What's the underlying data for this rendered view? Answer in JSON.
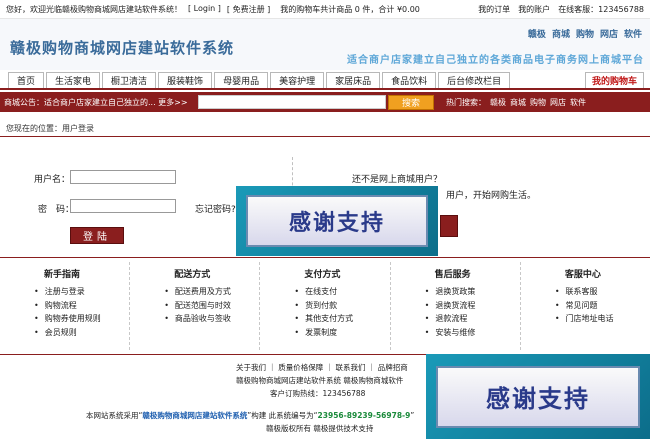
{
  "topbar": {
    "welcome": "您好，欢迎光临赣极购物商城网店建站软件系统！",
    "login": "[ Login ]",
    "register": "[ 免费注册 ]",
    "cart_summary": "我的购物车共计商品 0 件，合计 ¥0.00",
    "links": [
      "我的订单",
      "我的账户",
      "在线客服：123456788"
    ]
  },
  "header": {
    "brand": "赣极购物商城网店建站软件系统",
    "links": [
      "赣极",
      "商城",
      "购物",
      "网店",
      "软件"
    ],
    "slogan": "适合商户店家建立自己独立的各类商品电子商务网上商城平台"
  },
  "nav": {
    "tabs": [
      "首页",
      "生活家电",
      "橱卫清洁",
      "服装鞋饰",
      "母婴用品",
      "美容护理",
      "家居床品",
      "食品饮料",
      "后台修改栏目"
    ],
    "cart": "我的购物车"
  },
  "notice": {
    "text": "商城公告：适合商户店家建立自己独立的... 更多>>",
    "search_placeholder": "",
    "search_button": "搜索",
    "hot_label": "热门搜索：",
    "hot_terms": [
      "赣极",
      "商城",
      "购物",
      "网店",
      "软件"
    ]
  },
  "breadcrumb": "您现在的位置：用户登录",
  "login": {
    "username_label": "用户名：",
    "password_label": "密　码：",
    "forgot": "忘记密码?",
    "submit": "登陆",
    "not_user": "还不是网上商城用户？",
    "register_text": "用户，开始网购生活。"
  },
  "help": [
    {
      "title": "新手指南",
      "items": [
        "注册与登录",
        "购物流程",
        "购物券使用规则",
        "会员规则"
      ]
    },
    {
      "title": "配送方式",
      "items": [
        "配送费用及方式",
        "配送范围与时效",
        "商品验收与签收"
      ]
    },
    {
      "title": "支付方式",
      "items": [
        "在线支付",
        "货到付款",
        "其他支付方式",
        "发票制度"
      ]
    },
    {
      "title": "售后服务",
      "items": [
        "退换货政策",
        "退换货流程",
        "退款流程",
        "安装与维修"
      ]
    },
    {
      "title": "客服中心",
      "items": [
        "联系客服",
        "常见问题",
        "门店地址电话"
      ]
    }
  ],
  "footer": {
    "links": "关于我们 ｜ 质量价格保障 ｜ 联系我们 ｜ 品牌招商",
    "line2": "赣极购物商城网店建站软件系统 赣极购物商城软件",
    "hotline": "客户订购热线：123456788",
    "line4_prefix": "本网站系统采用“",
    "line4_link": "赣极购物商城网店建站软件系统",
    "line4_mid": "”构建 此系统编号为“",
    "line4_code": "23956-89239-56978-9",
    "line4_suffix": "”",
    "copyright": "赣极版权所有 赣极提供技术支持"
  },
  "watermark": "感谢支持"
}
